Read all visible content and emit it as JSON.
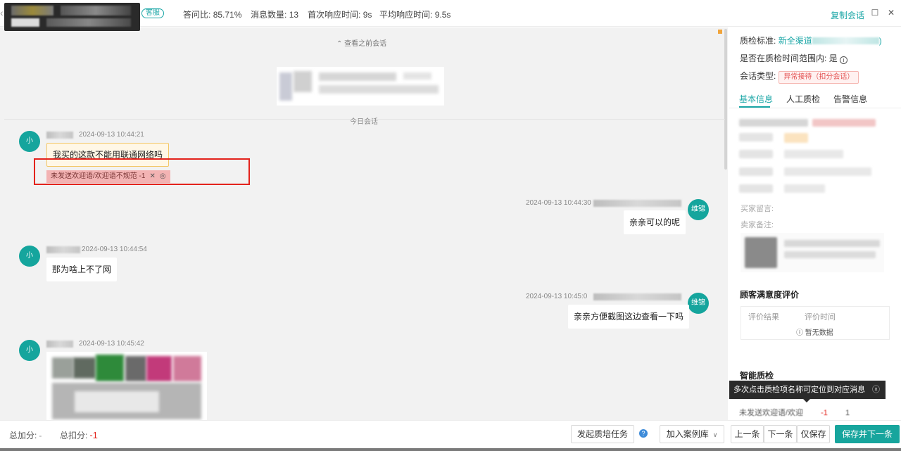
{
  "header": {
    "title_partial": "皿店满订",
    "role_tag": "客服",
    "stats": [
      {
        "label": "答问比:",
        "value": "85.71%"
      },
      {
        "label": "消息数量:",
        "value": "13"
      },
      {
        "label": "首次响应时间:",
        "value": "9s"
      },
      {
        "label": "平均响应时间:",
        "value": "9.5s"
      }
    ],
    "copy_session": "复制会话"
  },
  "chat": {
    "view_previous": "⌃ 查看之前会话",
    "today_label": "今日会话",
    "messages": [
      {
        "side": "left",
        "avatar": "小",
        "time": "2024-09-13 10:44:21",
        "text": "我买的这款不能用联通网络吗"
      },
      {
        "side": "right",
        "avatar": "维锦",
        "time": "2024-09-13 10:44:30",
        "text": "亲亲可以的呢"
      },
      {
        "side": "left",
        "avatar": "小",
        "time": "2024-09-13 10:44:54",
        "text": "那为啥上不了网"
      },
      {
        "side": "right",
        "avatar": "维锦",
        "time": "2024-09-13 10:45:0",
        "text": "亲亲方便截图这边查看一下吗"
      },
      {
        "side": "left",
        "avatar": "小",
        "time": "2024-09-13 10:45:42",
        "text": ""
      }
    ],
    "violation_tag": "未发送欢迎语/欢迎语不规范 -1",
    "violation_close": "✕",
    "violation_eye": "◎"
  },
  "right_panel": {
    "qc_standard_label": "质检标准:",
    "qc_standard_value": "新全渠道",
    "qc_standard_suffix": ")",
    "in_range_label": "是否在质检时间范围内:",
    "in_range_value": "是",
    "session_type_label": "会话类型:",
    "session_type_value": "异常接待（扣分会话）",
    "tabs": [
      "基本信息",
      "人工质检",
      "告警信息"
    ],
    "buyer_note_label": "买家留言:",
    "seller_note_label": "卖家备注:",
    "satisfaction_title": "顾客满意度评价",
    "satisfaction_headers": [
      "评价结果",
      "评价时间"
    ],
    "satisfaction_empty": "暂无数据",
    "smart_qc_title": "智能质检",
    "tooltip": "多次点击质检项名称可定位到对应消息",
    "qc_row_text": "未发送欢迎语/欢迎",
    "qc_row_score": "-1",
    "qc_row_count": "1"
  },
  "footer": {
    "total_add_label": "总加分:",
    "total_add_value": "-",
    "total_deduct_label": "总扣分:",
    "total_deduct_value": "-1",
    "btn_training": "发起质培任务",
    "btn_case_lib": "加入案例库",
    "btn_prev": "上一条",
    "btn_next": "下一条",
    "btn_save": "仅保存",
    "btn_save_next": "保存并下一条"
  },
  "colors": {
    "accent": "#17a59d",
    "danger": "#e3231c",
    "warn_bg": "#fff7e6"
  }
}
